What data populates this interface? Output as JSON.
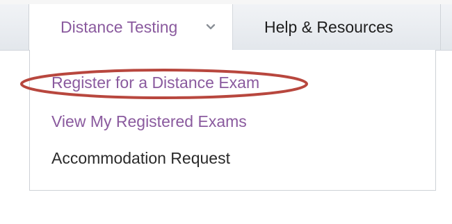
{
  "navbar": {
    "distance_testing_label": "Distance Testing",
    "help_resources_label": "Help & Resources"
  },
  "dropdown": {
    "items": [
      {
        "label": "Register for a Distance Exam"
      },
      {
        "label": "View My Registered Exams"
      },
      {
        "label": "Accommodation Request"
      }
    ]
  },
  "colors": {
    "link_purple": "#8a5a9e",
    "highlight_ellipse": "#b8473e",
    "text_dark": "#2a2a2a"
  },
  "icons": {
    "dropdown_chevron": "chevron-down-icon"
  }
}
